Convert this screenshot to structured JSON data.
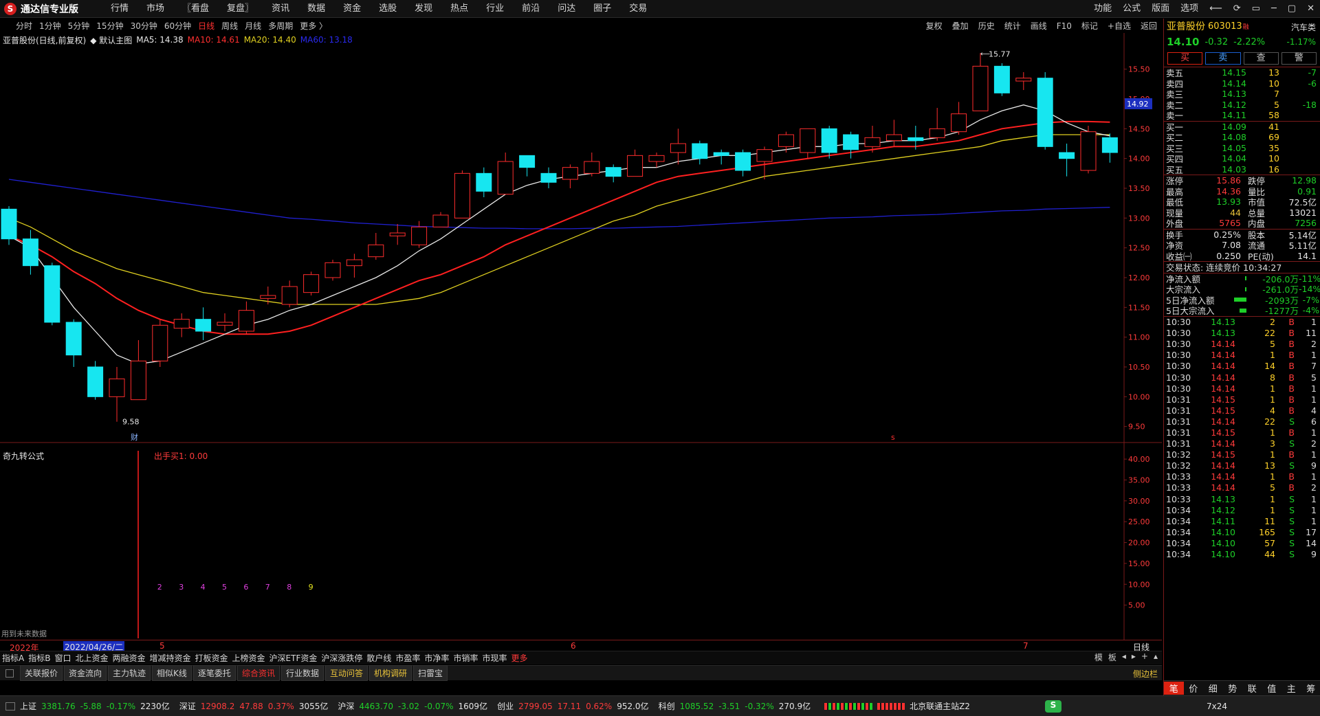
{
  "app": {
    "logo_char": "S",
    "title": "通达信专业版"
  },
  "menu": [
    "行情",
    "市场",
    "〖看盘",
    "复盘〗",
    "资讯",
    "数据",
    "资金",
    "选股",
    "发现",
    "热点",
    "行业",
    "前沿",
    "问达",
    "圈子",
    "交易"
  ],
  "menu_right": [
    "功能",
    "公式",
    "版面",
    "选项",
    "⟵",
    "⟳",
    "▭",
    "─",
    "▢",
    "✕"
  ],
  "periods": [
    "分时",
    "1分钟",
    "5分钟",
    "15分钟",
    "30分钟",
    "60分钟",
    "日线",
    "周线",
    "月线",
    "多周期",
    "更多 〉"
  ],
  "active_period": "日线",
  "chart_tools": [
    "复权",
    "叠加",
    "历史",
    "统计",
    "画线",
    "F10",
    "标记",
    "+自选",
    "返回"
  ],
  "legend": {
    "name": "亚普股份(日线,前复权)",
    "theme": "◆ 默认主图",
    "ma5": "MA5: 14.38",
    "ma10": "MA10: 14.61",
    "ma20": "MA20: 14.40",
    "ma60": "MA60: 13.18"
  },
  "colors": {
    "up": "#ff2d2d",
    "down": "#17e6f0",
    "ma5": "#e8e8e8",
    "ma10": "#ff2020",
    "ma20": "#e0d020",
    "ma60": "#2020d0",
    "grid_red": "#7a1a1a"
  },
  "price_axis": [
    "15.50",
    "15.00",
    "14.50",
    "14.00",
    "13.50",
    "13.00",
    "12.50",
    "12.00",
    "11.50",
    "11.00",
    "10.50",
    "10.00",
    "9.50"
  ],
  "current_price_tag": "14.92",
  "annotations": {
    "high": "15.77",
    "low": "9.58",
    "cai": "财",
    "s_mark": "s"
  },
  "sub_chart": {
    "name": "奇九转公式",
    "formula": "出手买1: 0.00",
    "axis": [
      "40.00",
      "35.00",
      "30.00",
      "25.00",
      "20.00",
      "15.00",
      "10.00",
      "5.00"
    ],
    "count_labels": [
      "2",
      "3",
      "4",
      "5",
      "6",
      "7",
      "8",
      "9"
    ],
    "note": "用到未来数据"
  },
  "time_axis": {
    "year": "2022年",
    "cursor_date": "2022/04/26/二",
    "months": [
      "5",
      "6",
      "7"
    ],
    "period": "日线"
  },
  "chart_data": {
    "type": "candlestick",
    "title": "亚普股份(日线,前复权)",
    "ylim": [
      9.3,
      15.9
    ],
    "candles": [
      [
        13.15,
        12.65,
        13.2,
        12.55
      ],
      [
        12.65,
        12.2,
        12.8,
        12.05
      ],
      [
        12.2,
        11.25,
        12.25,
        11.2
      ],
      [
        11.25,
        10.7,
        11.3,
        10.5
      ],
      [
        10.5,
        10.0,
        10.6,
        9.95
      ],
      [
        10.0,
        10.3,
        10.5,
        9.58
      ],
      [
        9.95,
        10.6,
        10.95,
        9.95
      ],
      [
        10.6,
        11.2,
        11.3,
        10.5
      ],
      [
        11.15,
        11.3,
        11.4,
        11.0
      ],
      [
        11.3,
        11.1,
        11.5,
        10.95
      ],
      [
        11.2,
        11.25,
        11.4,
        11.1
      ],
      [
        11.1,
        11.45,
        11.6,
        11.05
      ],
      [
        11.65,
        11.7,
        11.85,
        11.55
      ],
      [
        11.55,
        11.85,
        11.95,
        11.5
      ],
      [
        11.75,
        12.05,
        12.1,
        11.7
      ],
      [
        12.0,
        12.25,
        12.3,
        11.95
      ],
      [
        12.2,
        12.3,
        12.4,
        12.0
      ],
      [
        12.35,
        12.55,
        12.75,
        12.3
      ],
      [
        12.7,
        12.75,
        12.9,
        12.55
      ],
      [
        12.55,
        12.85,
        12.95,
        12.5
      ],
      [
        12.85,
        13.05,
        13.1,
        12.85
      ],
      [
        13.0,
        13.75,
        13.8,
        13.0
      ],
      [
        13.75,
        13.45,
        13.85,
        13.35
      ],
      [
        13.4,
        13.95,
        14.1,
        13.4
      ],
      [
        14.05,
        13.85,
        14.05,
        13.7
      ],
      [
        13.75,
        13.6,
        13.85,
        13.5
      ],
      [
        13.65,
        13.85,
        13.9,
        13.5
      ],
      [
        13.75,
        13.95,
        14.1,
        13.7
      ],
      [
        13.85,
        13.7,
        13.9,
        13.6
      ],
      [
        13.7,
        14.05,
        14.15,
        13.7
      ],
      [
        13.95,
        14.05,
        14.1,
        13.85
      ],
      [
        14.1,
        14.25,
        14.5,
        13.9
      ],
      [
        14.25,
        14.0,
        14.3,
        13.9
      ],
      [
        14.1,
        14.05,
        14.15,
        13.9
      ],
      [
        14.1,
        13.8,
        14.15,
        13.7
      ],
      [
        13.95,
        14.15,
        14.2,
        13.65
      ],
      [
        14.2,
        14.4,
        14.45,
        14.1
      ],
      [
        14.1,
        14.5,
        14.5,
        14.0
      ],
      [
        14.5,
        14.1,
        14.55,
        14.0
      ],
      [
        14.4,
        14.15,
        14.45,
        14.0
      ],
      [
        14.2,
        14.35,
        14.55,
        14.1
      ],
      [
        14.3,
        14.4,
        14.65,
        14.2
      ],
      [
        14.35,
        14.3,
        14.55,
        14.15
      ],
      [
        14.35,
        14.5,
        14.85,
        14.3
      ],
      [
        14.45,
        14.75,
        14.95,
        14.4
      ],
      [
        14.8,
        15.55,
        15.77,
        14.8
      ],
      [
        15.55,
        15.1,
        15.6,
        15.05
      ],
      [
        15.3,
        15.35,
        15.45,
        15.15
      ],
      [
        15.35,
        14.2,
        15.45,
        14.15
      ],
      [
        14.1,
        14.0,
        14.25,
        13.7
      ],
      [
        13.8,
        14.45,
        14.55,
        13.75
      ],
      [
        14.35,
        14.1,
        14.42,
        13.93
      ]
    ],
    "ma5": [
      12.7,
      12.5,
      12.0,
      11.5,
      11.1,
      10.7,
      10.55,
      10.6,
      10.75,
      10.9,
      11.05,
      11.2,
      11.3,
      11.45,
      11.55,
      11.7,
      11.85,
      12.0,
      12.2,
      12.45,
      12.65,
      12.9,
      13.15,
      13.4,
      13.55,
      13.65,
      13.7,
      13.75,
      13.8,
      13.85,
      13.85,
      13.95,
      14.0,
      14.05,
      14.05,
      14.1,
      14.15,
      14.2,
      14.2,
      14.25,
      14.25,
      14.3,
      14.3,
      14.35,
      14.45,
      14.65,
      14.8,
      14.9,
      14.8,
      14.6,
      14.45,
      14.38
    ],
    "ma10": [
      12.7,
      12.55,
      12.35,
      12.1,
      11.9,
      11.65,
      11.45,
      11.3,
      11.2,
      11.1,
      11.05,
      11.05,
      11.05,
      11.1,
      11.2,
      11.35,
      11.5,
      11.65,
      11.8,
      11.95,
      12.05,
      12.2,
      12.35,
      12.55,
      12.7,
      12.85,
      13.0,
      13.15,
      13.3,
      13.45,
      13.6,
      13.7,
      13.75,
      13.8,
      13.85,
      13.9,
      13.95,
      14.0,
      14.05,
      14.1,
      14.15,
      14.2,
      14.2,
      14.25,
      14.3,
      14.4,
      14.5,
      14.55,
      14.6,
      14.62,
      14.62,
      14.61
    ],
    "ma20": [
      13.0,
      12.85,
      12.65,
      12.45,
      12.3,
      12.15,
      12.05,
      11.95,
      11.85,
      11.75,
      11.7,
      11.65,
      11.6,
      11.55,
      11.55,
      11.55,
      11.55,
      11.55,
      11.6,
      11.65,
      11.75,
      11.9,
      12.05,
      12.2,
      12.35,
      12.5,
      12.65,
      12.8,
      12.95,
      13.05,
      13.2,
      13.3,
      13.4,
      13.5,
      13.6,
      13.7,
      13.75,
      13.8,
      13.85,
      13.9,
      13.95,
      14.0,
      14.05,
      14.1,
      14.15,
      14.2,
      14.3,
      14.35,
      14.4,
      14.4,
      14.4,
      14.4
    ],
    "ma60": [
      13.65,
      13.6,
      13.55,
      13.5,
      13.45,
      13.4,
      13.35,
      13.3,
      13.25,
      13.2,
      13.15,
      13.1,
      13.05,
      13.0,
      12.98,
      12.95,
      12.92,
      12.9,
      12.88,
      12.86,
      12.85,
      12.84,
      12.83,
      12.83,
      12.82,
      12.82,
      12.82,
      12.83,
      12.83,
      12.84,
      12.85,
      12.86,
      12.88,
      12.9,
      12.92,
      12.94,
      12.96,
      12.98,
      13.0,
      13.01,
      13.02,
      13.04,
      13.05,
      13.06,
      13.08,
      13.1,
      13.12,
      13.13,
      13.15,
      13.16,
      13.17,
      13.18
    ]
  },
  "quote": {
    "name": "亚普股份",
    "code": "603013",
    "code_tag": "融",
    "sector": "汽车类",
    "price": "14.10",
    "change": "-0.32",
    "pct": "-2.22%",
    "sector_pct": "-1.17%",
    "buttons": [
      "买",
      "卖",
      "查",
      "警"
    ],
    "asks": [
      {
        "label": "卖五",
        "price": "14.15",
        "vol": "13",
        "chg": "-7"
      },
      {
        "label": "卖四",
        "price": "14.14",
        "vol": "10",
        "chg": "-6"
      },
      {
        "label": "卖三",
        "price": "14.13",
        "vol": "7",
        "chg": ""
      },
      {
        "label": "卖二",
        "price": "14.12",
        "vol": "5",
        "chg": "-18"
      },
      {
        "label": "卖一",
        "price": "14.11",
        "vol": "58",
        "chg": ""
      }
    ],
    "bids": [
      {
        "label": "买一",
        "price": "14.09",
        "vol": "41",
        "chg": ""
      },
      {
        "label": "买二",
        "price": "14.08",
        "vol": "69",
        "chg": ""
      },
      {
        "label": "买三",
        "price": "14.05",
        "vol": "35",
        "chg": ""
      },
      {
        "label": "买四",
        "price": "14.04",
        "vol": "10",
        "chg": ""
      },
      {
        "label": "买五",
        "price": "14.03",
        "vol": "16",
        "chg": ""
      }
    ],
    "stats": [
      {
        "k": "涨停",
        "v": "15.86",
        "vc": "red",
        "k2": "跌停",
        "v2": "12.98",
        "v2c": "green"
      },
      {
        "k": "最高",
        "v": "14.36",
        "vc": "red",
        "k2": "量比",
        "v2": "0.91",
        "v2c": "green"
      },
      {
        "k": "最低",
        "v": "13.93",
        "vc": "green",
        "k2": "市值",
        "v2": "72.5亿",
        "v2c": "white"
      },
      {
        "k": "现量",
        "v": "44",
        "vc": "yellow",
        "k2": "总量",
        "v2": "13021",
        "v2c": "white"
      },
      {
        "k": "外盘",
        "v": "5765",
        "vc": "red",
        "k2": "内盘",
        "v2": "7256",
        "v2c": "green"
      }
    ],
    "stats2": [
      {
        "k": "换手",
        "v": "0.25%",
        "k2": "股本",
        "v2": "5.14亿"
      },
      {
        "k": "净资",
        "v": "7.08",
        "k2": "流通",
        "v2": "5.11亿"
      },
      {
        "k": "收益㈠",
        "v": "0.250",
        "k2": "PE(动)",
        "v2": "14.1"
      }
    ],
    "trade_status": "交易状态: 连续竞价 10:34:27",
    "flows": [
      {
        "k": "净流入额",
        "v": "-206.0万",
        "p": "-11%",
        "bar": 2
      },
      {
        "k": "大宗流入",
        "v": "-261.0万",
        "p": "-14%",
        "bar": 2
      },
      {
        "k": "5日净流入额",
        "v": "-2093万",
        "p": "-7%",
        "bar": 18
      },
      {
        "k": "5日大宗流入",
        "v": "-1277万",
        "p": "-4%",
        "bar": 10
      }
    ],
    "ticks": [
      [
        "10:30",
        "14.13",
        "2",
        "B",
        "1"
      ],
      [
        "10:30",
        "14.13",
        "22",
        "B",
        "11"
      ],
      [
        "10:30",
        "14.14",
        "5",
        "B",
        "2"
      ],
      [
        "10:30",
        "14.14",
        "1",
        "B",
        "1"
      ],
      [
        "10:30",
        "14.14",
        "14",
        "B",
        "7"
      ],
      [
        "10:30",
        "14.14",
        "8",
        "B",
        "5"
      ],
      [
        "10:30",
        "14.14",
        "1",
        "B",
        "1"
      ],
      [
        "10:31",
        "14.15",
        "1",
        "B",
        "1"
      ],
      [
        "10:31",
        "14.15",
        "4",
        "B",
        "4"
      ],
      [
        "10:31",
        "14.14",
        "22",
        "S",
        "6"
      ],
      [
        "10:31",
        "14.15",
        "1",
        "B",
        "1"
      ],
      [
        "10:31",
        "14.14",
        "3",
        "S",
        "2"
      ],
      [
        "10:32",
        "14.15",
        "1",
        "B",
        "1"
      ],
      [
        "10:32",
        "14.14",
        "13",
        "S",
        "9"
      ],
      [
        "10:33",
        "14.14",
        "1",
        "B",
        "1"
      ],
      [
        "10:33",
        "14.14",
        "5",
        "B",
        "2"
      ],
      [
        "10:33",
        "14.13",
        "1",
        "S",
        "1"
      ],
      [
        "10:34",
        "14.12",
        "1",
        "S",
        "1"
      ],
      [
        "10:34",
        "14.11",
        "11",
        "S",
        "1"
      ],
      [
        "10:34",
        "14.10",
        "165",
        "S",
        "17"
      ],
      [
        "10:34",
        "14.10",
        "57",
        "S",
        "14"
      ],
      [
        "10:34",
        "14.10",
        "44",
        "S",
        "9"
      ]
    ],
    "bottom_tabs": [
      "笔",
      "价",
      "细",
      "势",
      "联",
      "值",
      "主",
      "筹"
    ]
  },
  "tabs1": [
    "指标A",
    "指标B",
    "窗口",
    "北上资金",
    "两融资金",
    "增减持资金",
    "打板资金",
    "上榜资金",
    "沪深ETF资金",
    "沪深涨跌停",
    "散户线",
    "市盈率",
    "市净率",
    "市销率",
    "市现率",
    "更多"
  ],
  "tabs1_right": [
    "模",
    "板",
    "◂",
    "▸",
    "+",
    "▴"
  ],
  "tabs2": [
    "关联报价",
    "资金流向",
    "主力轨迹",
    "相似K线",
    "逐笔委托",
    "综合资讯",
    "行业数据",
    "互动问答",
    "机构调研",
    "扫雷宝"
  ],
  "tabs2_active": "综合资讯",
  "side_btn": "侧边栏",
  "status": {
    "sh": {
      "label": "上证",
      "v": "3381.76",
      "c": "-5.88",
      "p": "-0.17%",
      "a": "2230亿"
    },
    "sz": {
      "label": "深证",
      "v": "12908.2",
      "c": "47.88",
      "p": "0.37%",
      "a": "3055亿"
    },
    "hs": {
      "label": "沪深",
      "v": "4463.70",
      "c": "-3.02",
      "p": "-0.07%",
      "a": "1609亿"
    },
    "cy": {
      "label": "创业",
      "v": "2799.05",
      "c": "17.11",
      "p": "0.62%",
      "a": "952.0亿"
    },
    "kc": {
      "label": "科创",
      "v": "1085.52",
      "c": "-3.51",
      "p": "-0.32%",
      "a": "270.9亿"
    },
    "server": "北京联通主站Z2",
    "right": "7x24"
  }
}
